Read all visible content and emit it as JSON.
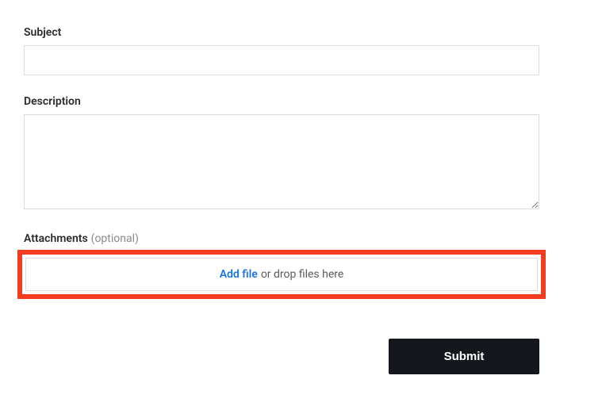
{
  "form": {
    "subject": {
      "label": "Subject",
      "value": ""
    },
    "description": {
      "label": "Description",
      "value": ""
    },
    "attachments": {
      "label": "Attachments",
      "optional_text": "(optional)",
      "add_file_label": "Add file",
      "drop_text": "or drop files here"
    },
    "submit_label": "Submit"
  }
}
